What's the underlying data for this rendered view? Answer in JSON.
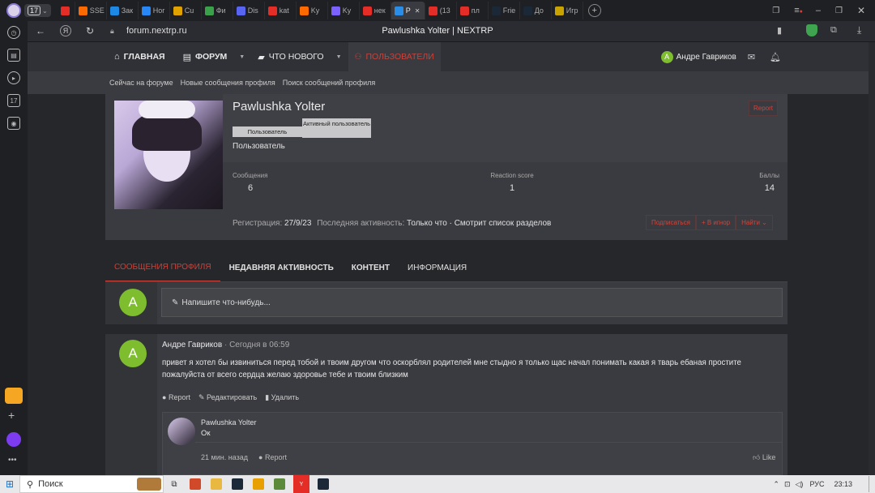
{
  "browser": {
    "tab_count": "17",
    "tabs": [
      {
        "label": "",
        "color": "#e52d27",
        "icon": "youtube-icon"
      },
      {
        "label": "SSE",
        "color": "#ff6a00",
        "icon": "dns-icon"
      },
      {
        "label": "Зак",
        "color": "#1e88e5",
        "icon": "chat-icon"
      },
      {
        "label": "Hor",
        "color": "#2787f5",
        "icon": "vk-icon"
      },
      {
        "label": "Cu",
        "color": "#e0a200",
        "icon": "in-icon"
      },
      {
        "label": "Фи",
        "color": "#3aa14a",
        "icon": "hd-icon"
      },
      {
        "label": "Dis",
        "color": "#5865f2",
        "icon": "discord-icon"
      },
      {
        "label": "kat",
        "color": "#e52d27",
        "icon": "yandex-icon"
      },
      {
        "label": "Ky",
        "color": "#ff6a00",
        "icon": "dns-icon"
      },
      {
        "label": "Ky",
        "color": "#7b61ff",
        "icon": "check-icon"
      },
      {
        "label": "нек",
        "color": "#e52d27",
        "icon": "yandex-icon"
      },
      {
        "label": "P",
        "color": "#2a8ee8",
        "icon": "site-icon"
      },
      {
        "label": "(13",
        "color": "#e52d27",
        "icon": "youtube-icon"
      },
      {
        "label": "пл",
        "color": "#e52d27",
        "icon": "yandex-icon"
      },
      {
        "label": "Frie",
        "color": "#1b2838",
        "icon": "steam-icon"
      },
      {
        "label": "До",
        "color": "#1b2838",
        "icon": "steam-icon"
      },
      {
        "label": "Игр",
        "color": "#c9a400",
        "icon": "game-icon"
      }
    ],
    "url": "forum.nextrp.ru",
    "page_title": "Pawlushka Yolter | NEXTRP"
  },
  "nav": {
    "home": "ГЛАВНАЯ",
    "forum": "ФОРУМ",
    "whats_new": "ЧТО НОВОГО",
    "users": "ПОЛЬЗОВАТЕЛИ",
    "user_initial": "A",
    "user_name": "Андре Гавриков"
  },
  "subnav": [
    "Сейчас на форуме",
    "Новые сообщения профиля",
    "Поиск сообщений профиля"
  ],
  "profile": {
    "name": "Pawlushka Yolter",
    "banner1": "Пользователь",
    "banner2": "Активный пользователь",
    "title": "Пользователь",
    "report": "Report",
    "stats": [
      {
        "label": "Сообщения",
        "value": "6"
      },
      {
        "label": "Reaction score",
        "value": "1"
      },
      {
        "label": "Баллы",
        "value": "14"
      }
    ],
    "reg_label": "Регистрация:",
    "reg_date": "27/9/23",
    "last_label": "Последняя активность:",
    "last_value": "Только что · Смотрит список разделов",
    "subscribe": "Подписаться",
    "ignore": "+ В игнор",
    "find": "Найти"
  },
  "tabs": [
    "СООБЩЕНИЯ ПРОФИЛЯ",
    "НЕДАВНЯЯ АКТИВНОСТЬ",
    "КОНТЕНТ",
    "ИНФОРМАЦИЯ"
  ],
  "composer": {
    "initial": "A",
    "placeholder": "Напишите что-нибудь..."
  },
  "post": {
    "initial": "A",
    "author": "Андре Гавриков",
    "time": "Сегодня в 06:59",
    "text": "привет я хотел бы извиниться перед тобой и твоим другом что оскорблял родителей мне стыдно я только щас начал понимать какая я тварь ебаная простите пожалуйста от всего сердца желаю здоровье тебе и твоим близким",
    "report": "Report",
    "edit": "Редактировать",
    "delete": "Удалить"
  },
  "reply": {
    "author": "Pawlushka Yolter",
    "text": "Ок",
    "time": "21 мин. назад",
    "report": "Report",
    "like": "Like"
  },
  "taskbar": {
    "search": "Поиск",
    "lang": "РУС",
    "clock": "23:13"
  }
}
